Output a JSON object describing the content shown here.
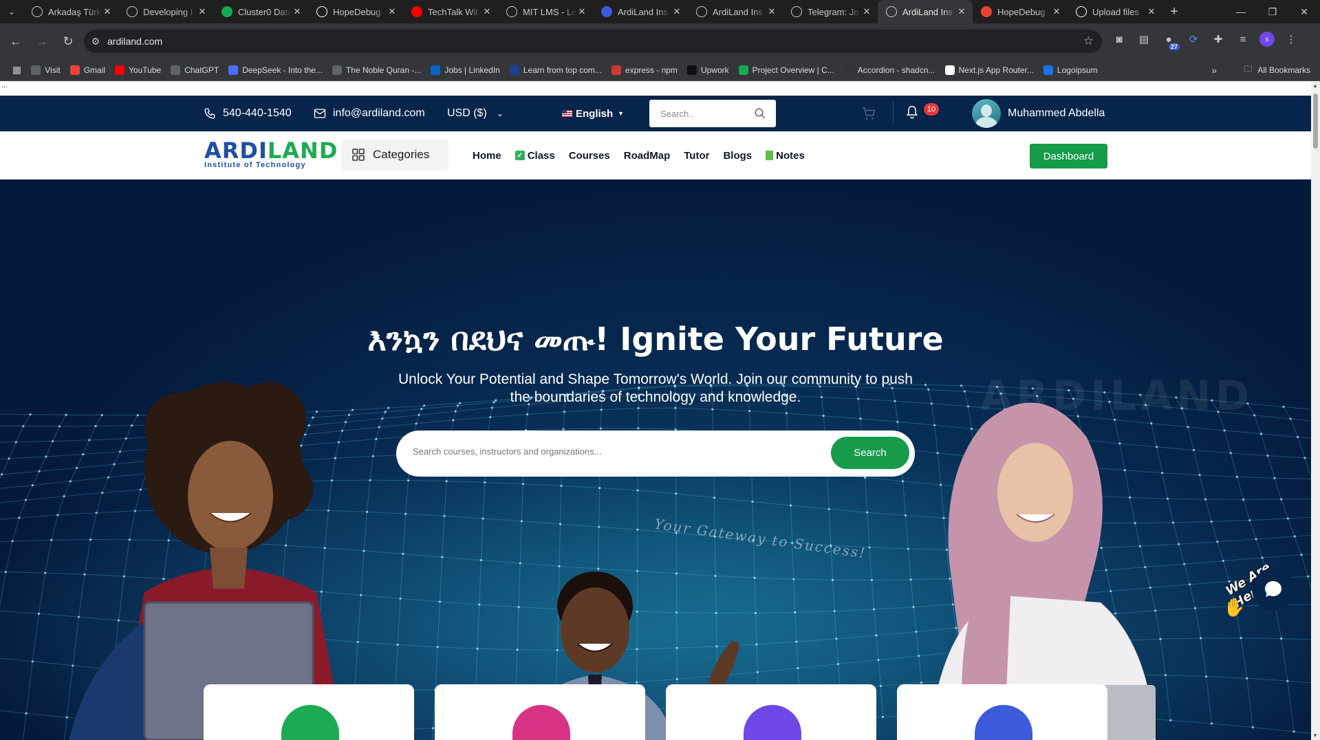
{
  "browser": {
    "tabs": [
      {
        "title": "Arkadaş Türk",
        "favicon_color": "#5f6368",
        "favicon": "globe-icon"
      },
      {
        "title": "Developing I",
        "favicon_color": "#5f6368",
        "favicon": "sync-icon"
      },
      {
        "title": "Cluster0 Data",
        "favicon_color": "#13aa52",
        "favicon": "mongodb-leaf-icon"
      },
      {
        "title": "HopeDebug",
        "favicon_color": "#ffffff",
        "favicon": "github-icon"
      },
      {
        "title": "TechTalk Wit",
        "favicon_color": "#ff0000",
        "favicon": "youtube-icon"
      },
      {
        "title": "MIT LMS - Le",
        "favicon_color": "#5f6368",
        "favicon": "globe-icon"
      },
      {
        "title": "ArdiLand Ins",
        "favicon_color": "#3b5bdb",
        "favicon": "ardiland-icon"
      },
      {
        "title": "ArdiLand Ins",
        "favicon_color": "#5f6368",
        "favicon": "globe-icon"
      },
      {
        "title": "Telegram: Jo",
        "favicon_color": "#5f6368",
        "favicon": "globe-icon"
      },
      {
        "title": "ArdiLand Ins",
        "favicon_color": "#5f6368",
        "favicon": "globe-icon",
        "active": true
      },
      {
        "title": "HopeDebug",
        "favicon_color": "#ea4335",
        "favicon": "gmail-icon"
      },
      {
        "title": "Upload files",
        "favicon_color": "#ffffff",
        "favicon": "github-icon"
      }
    ],
    "url": "ardiland.com",
    "extension_badge": "27",
    "profile_initial": "s",
    "bookmarks": [
      {
        "label": "Visit",
        "color": "#5f6368"
      },
      {
        "label": "Gmail",
        "color": "#ea4335"
      },
      {
        "label": "YouTube",
        "color": "#ff0000"
      },
      {
        "label": "ChatGPT",
        "color": "#5f6368"
      },
      {
        "label": "DeepSeek - Into the...",
        "color": "#4d6bfe"
      },
      {
        "label": "The Noble Quran -...",
        "color": "#5f6368"
      },
      {
        "label": "Jobs | LinkedIn",
        "color": "#0a66c2"
      },
      {
        "label": "Learn from top com...",
        "color": "#1c3f94"
      },
      {
        "label": "express - npm",
        "color": "#cb3837"
      },
      {
        "label": "Upwork",
        "color": "#111111"
      },
      {
        "label": "Project Overview | C...",
        "color": "#13aa52"
      },
      {
        "label": "Accordion - shadcn...",
        "color": "#333333"
      },
      {
        "label": "Next.js App Router...",
        "color": "#ffffff"
      },
      {
        "label": "Logoipsum",
        "color": "#1a73e8"
      }
    ],
    "all_bookmarks_label": "All Bookmarks"
  },
  "page": {
    "dots": "...",
    "topbar": {
      "phone": "540-440-1540",
      "email": "info@ardiland.com",
      "currency": "USD ($)",
      "language": "English",
      "search_placeholder": "Search..",
      "notification_count": "10",
      "user_name": "Muhammed Abdella"
    },
    "nav": {
      "logo_part1": "ARDI",
      "logo_part2": "LAND",
      "logo_sub": "Institute of Technology",
      "categories_label": "Categories",
      "menu": [
        "Home",
        "Class",
        "Courses",
        "RoadMap",
        "Tutor",
        "Blogs",
        "Notes"
      ],
      "dashboard_label": "Dashboard"
    },
    "hero": {
      "title": "እንኳን በደህና መጡ! Ignite Your Future",
      "subtitle": "Unlock Your Potential and Shape Tomorrow's World. Join our community to push the boundaries of technology and knowledge.",
      "search_placeholder": "Search courses, instructors and organizations...",
      "search_button": "Search",
      "watermark": "ARDILAND",
      "tagline": "Your Gateway to Success!"
    },
    "feature_cards": [
      {
        "icon_color": "#1eaa55"
      },
      {
        "icon_color": "#d63384"
      },
      {
        "icon_color": "#7048e8"
      },
      {
        "icon_color": "#3b5bdb"
      }
    ],
    "chat": {
      "label": "We Are Here!"
    }
  }
}
